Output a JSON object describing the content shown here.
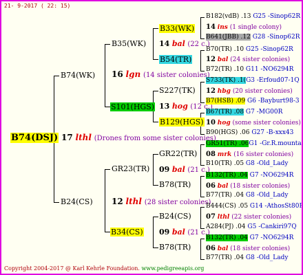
{
  "header": {
    "date": "21-  9-2017 ( 22: 15)"
  },
  "root": {
    "label": "B74(DSJ)",
    "num": "17",
    "name": "lthl",
    "note": "(Drones from some sister colonies)"
  },
  "gen1": [
    {
      "label": "B74(WK)",
      "num": "16",
      "name": "lgn",
      "note": "(14 sister colonies)"
    },
    {
      "label": "B24(CS)",
      "num": "12",
      "name": "lthl",
      "note": "(28 sister colonies)"
    }
  ],
  "gen2": [
    {
      "label": "B35(WK)"
    },
    {
      "label": "S101(HGS)"
    },
    {
      "label": "GR23(TR)"
    },
    {
      "label": "B34(CS)"
    }
  ],
  "gen3": [
    {
      "label": "B33(WK)",
      "num": "14",
      "name": "bal",
      "note": "(22 c.)"
    },
    {
      "label": "B54(TR)"
    },
    {
      "label": "S227(TK)",
      "num": "13",
      "name": "hog",
      "note": "(12 c.)"
    },
    {
      "label": "B129(HGS)"
    },
    {
      "label": "GR22(TR)",
      "num": "09",
      "name": "bal",
      "note": "(21 c.)"
    },
    {
      "label": "B78(TR)"
    },
    {
      "label": "B24(CS)",
      "num": "09",
      "name": "bal",
      "note": "(21 c.)"
    },
    {
      "label": "B78(TR)"
    }
  ],
  "gen4": [
    {
      "a": "B182(vdB) .13",
      "b": "G25 -Sinop62R"
    },
    {
      "a": "14",
      "b": "ins",
      "c": "(1 single colony)"
    },
    {
      "a": "B641(JBB) .12",
      "b": "G28 -Sinop62R"
    },
    {
      "a": "B70(TR) .10",
      "b": "G25 -Sinop62R"
    },
    {
      "a": "12",
      "b": "bal",
      "c": "(24 sister colonies)"
    },
    {
      "a": "B72(TR) .10",
      "b": "G11 -NO6294R"
    },
    {
      "a": "S733(TK) .1(",
      "b": "G3 -Erfoud07-1Q"
    },
    {
      "a": "12",
      "b": "hbg",
      "c": "(20 sister colonies)"
    },
    {
      "a": "B7(HSB) .09",
      "b": "G6 -Bayburt98-3"
    },
    {
      "a": "B67(TR) .08",
      "b": "G7 -MG00R"
    },
    {
      "a": "10",
      "b": "hog",
      "c": "(some sister colonies)"
    },
    {
      "a": "B90(HGS) .06",
      "b": "G27 -B-xxx43"
    },
    {
      "a": "GR51(TR) .06",
      "b": "G1 -Gr.R.mounta"
    },
    {
      "a": "08",
      "b": "mrk",
      "c": "(16 sister colonies)"
    },
    {
      "a": "B10(TR) .05",
      "b": "G8 -Old_Lady"
    },
    {
      "a": "B132(TR) .04",
      "b": "G7 -NO6294R"
    },
    {
      "a": "06",
      "b": "bal",
      "c": "(18 sister colonies)"
    },
    {
      "a": "B77(TR) .04",
      "b": "G8 -Old_Lady"
    },
    {
      "a": "B444(CS) .05",
      "b": "G14 -AthosSt80R"
    },
    {
      "a": "07",
      "b": "lthl",
      "c": "(22 sister colonies)"
    },
    {
      "a": "A284(PJ) .04",
      "b": "G5 -Cankiri97Q"
    },
    {
      "a": "B132(TR) .04",
      "b": "G7 -NO6294R"
    },
    {
      "a": "06",
      "b": "bal",
      "c": "(18 sister colonies)"
    },
    {
      "a": "B77(TR) .04",
      "b": "G8 -Old_Lady"
    }
  ],
  "footer": {
    "copy": "Copyright 2004-2017 @ Karl Kehrle Foundation.",
    "url": "www.pedigreeapis.org"
  },
  "colors": {
    "border": "#e000e0",
    "yellow": "#ffff00",
    "cyan": "#33d6e0",
    "green": "#00cc00",
    "red": "#e00000",
    "purple": "#8000a0",
    "blue": "#0000c0"
  }
}
